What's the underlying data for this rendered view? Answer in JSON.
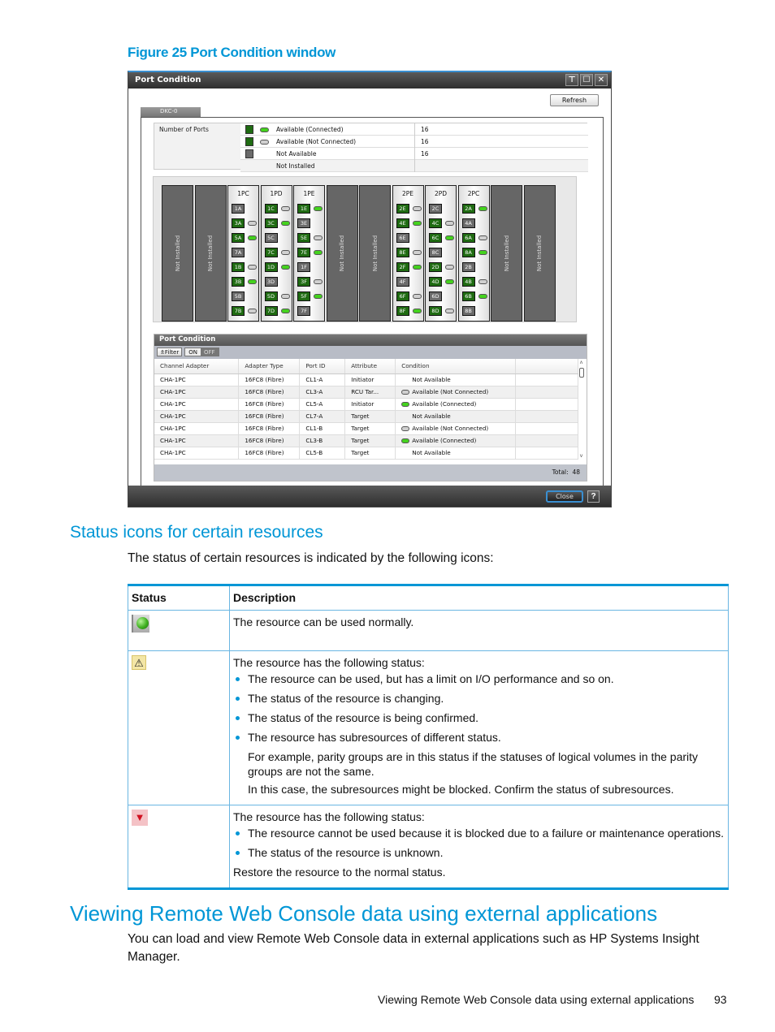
{
  "figure": {
    "caption": "Figure 25 Port Condition window"
  },
  "window": {
    "title": "Port Condition",
    "title_buttons": [
      "pin-icon",
      "maximize-icon",
      "close-icon"
    ],
    "title_button_glyphs": [
      "⊤",
      "☐",
      "✕"
    ],
    "refresh_label": "Refresh",
    "tab_label": "DKC-0",
    "number_of_ports": {
      "label": "Number of Ports",
      "rows": [
        {
          "square": "green",
          "pill": "green",
          "label": "Available (Connected)",
          "value": "16"
        },
        {
          "square": "green",
          "pill": "gray",
          "label": "Available (Not Connected)",
          "value": "16"
        },
        {
          "square": "gray",
          "pill": "",
          "label": "Not Available",
          "value": "16"
        },
        {
          "square": "",
          "pill": "",
          "label": "Not Installed",
          "value": ""
        }
      ]
    },
    "rack": {
      "not_installed_label": "Not Installed",
      "slots": [
        {
          "type": "ni"
        },
        {
          "type": "ni"
        },
        {
          "type": "ad",
          "name": "1PC",
          "ports": [
            {
              "id": "1A",
              "state": "gray",
              "led": ""
            },
            {
              "id": "3A",
              "state": "green",
              "led": "gray"
            },
            {
              "id": "5A",
              "state": "green",
              "led": "green"
            },
            {
              "id": "7A",
              "state": "gray",
              "led": ""
            },
            {
              "id": "1B",
              "state": "green",
              "led": "gray"
            },
            {
              "id": "3B",
              "state": "green",
              "led": "green"
            },
            {
              "id": "5B",
              "state": "gray",
              "led": ""
            },
            {
              "id": "7B",
              "state": "green",
              "led": "gray"
            }
          ]
        },
        {
          "type": "ad",
          "name": "1PD",
          "ports": [
            {
              "id": "1C",
              "state": "green",
              "led": "gray"
            },
            {
              "id": "3C",
              "state": "green",
              "led": "green"
            },
            {
              "id": "5C",
              "state": "gray",
              "led": ""
            },
            {
              "id": "7C",
              "state": "green",
              "led": "gray"
            },
            {
              "id": "1D",
              "state": "green",
              "led": "green"
            },
            {
              "id": "3D",
              "state": "gray",
              "led": ""
            },
            {
              "id": "5D",
              "state": "green",
              "led": "gray"
            },
            {
              "id": "7D",
              "state": "green",
              "led": "green"
            }
          ]
        },
        {
          "type": "ad",
          "name": "1PE",
          "ports": [
            {
              "id": "1E",
              "state": "green",
              "led": "green"
            },
            {
              "id": "3E",
              "state": "gray",
              "led": ""
            },
            {
              "id": "5E",
              "state": "green",
              "led": "gray"
            },
            {
              "id": "7E",
              "state": "green",
              "led": "green"
            },
            {
              "id": "1F",
              "state": "gray",
              "led": ""
            },
            {
              "id": "3F",
              "state": "green",
              "led": "gray"
            },
            {
              "id": "5F",
              "state": "green",
              "led": "green"
            },
            {
              "id": "7F",
              "state": "gray",
              "led": ""
            }
          ]
        },
        {
          "type": "ni"
        },
        {
          "type": "ni"
        },
        {
          "type": "ad",
          "name": "2PE",
          "ports": [
            {
              "id": "2E",
              "state": "green",
              "led": "gray"
            },
            {
              "id": "4E",
              "state": "green",
              "led": "green"
            },
            {
              "id": "6E",
              "state": "gray",
              "led": ""
            },
            {
              "id": "8E",
              "state": "green",
              "led": "gray"
            },
            {
              "id": "2F",
              "state": "green",
              "led": "green"
            },
            {
              "id": "4F",
              "state": "gray",
              "led": ""
            },
            {
              "id": "6F",
              "state": "green",
              "led": "gray"
            },
            {
              "id": "8F",
              "state": "green",
              "led": "green"
            }
          ]
        },
        {
          "type": "ad",
          "name": "2PD",
          "ports": [
            {
              "id": "2C",
              "state": "gray",
              "led": ""
            },
            {
              "id": "4C",
              "state": "green",
              "led": "gray"
            },
            {
              "id": "6C",
              "state": "green",
              "led": "green"
            },
            {
              "id": "8C",
              "state": "gray",
              "led": ""
            },
            {
              "id": "2D",
              "state": "green",
              "led": "gray"
            },
            {
              "id": "4D",
              "state": "green",
              "led": "green"
            },
            {
              "id": "6D",
              "state": "gray",
              "led": ""
            },
            {
              "id": "8D",
              "state": "green",
              "led": "gray"
            }
          ]
        },
        {
          "type": "ad",
          "name": "2PC",
          "ports": [
            {
              "id": "2A",
              "state": "green",
              "led": "green"
            },
            {
              "id": "4A",
              "state": "gray",
              "led": ""
            },
            {
              "id": "6A",
              "state": "green",
              "led": "gray"
            },
            {
              "id": "8A",
              "state": "green",
              "led": "green"
            },
            {
              "id": "2B",
              "state": "gray",
              "led": ""
            },
            {
              "id": "4B",
              "state": "green",
              "led": "gray"
            },
            {
              "id": "6B",
              "state": "green",
              "led": "green"
            },
            {
              "id": "8B",
              "state": "gray",
              "led": ""
            }
          ]
        },
        {
          "type": "ni"
        },
        {
          "type": "ni"
        }
      ]
    },
    "port_condition": {
      "title": "Port Condition",
      "filter_label": "Filter",
      "on_label": "ON",
      "off_label": "OFF",
      "columns": [
        "Channel Adapter",
        "Adapter Type",
        "Port ID",
        "Attribute",
        "Condition",
        ""
      ],
      "rows": [
        [
          "CHA-1PC",
          "16FC8 (Fibre)",
          "CL1-A",
          "Initiator",
          "none",
          "Not Available"
        ],
        [
          "CHA-1PC",
          "16FC8 (Fibre)",
          "CL3-A",
          "RCU Tar...",
          "gray",
          "Available (Not Connected)"
        ],
        [
          "CHA-1PC",
          "16FC8 (Fibre)",
          "CL5-A",
          "Initiator",
          "green",
          "Available (Connected)"
        ],
        [
          "CHA-1PC",
          "16FC8 (Fibre)",
          "CL7-A",
          "Target",
          "none",
          "Not Available"
        ],
        [
          "CHA-1PC",
          "16FC8 (Fibre)",
          "CL1-B",
          "Target",
          "gray",
          "Available (Not Connected)"
        ],
        [
          "CHA-1PC",
          "16FC8 (Fibre)",
          "CL3-B",
          "Target",
          "green",
          "Available (Connected)"
        ],
        [
          "CHA-1PC",
          "16FC8 (Fibre)",
          "CL5-B",
          "Target",
          "none",
          "Not Available"
        ]
      ],
      "total_label": "Total:",
      "total_value": "48"
    },
    "close_label": "Close",
    "help_label": "?"
  },
  "section1": {
    "heading": "Status icons for certain resources",
    "intro": "The status of certain resources is indicated by the following icons:",
    "table": {
      "headers": [
        "Status",
        "Description"
      ],
      "rows": [
        {
          "icon": "green-status-icon",
          "lead": "The resource can be used normally.",
          "bullets": [],
          "notes": [],
          "trailer": ""
        },
        {
          "icon": "warning-icon",
          "lead": "The resource has the following status:",
          "bullets": [
            "The resource can be used, but has a limit on I/O performance and so on.",
            "The status of the resource is changing.",
            "The status of the resource is being confirmed.",
            "The resource has subresources of different status."
          ],
          "notes": [
            "For example, parity groups are in this status if the statuses of logical volumes in the parity groups are not the same.",
            "In this case, the subresources might be blocked. Confirm the status of subresources."
          ],
          "trailer": ""
        },
        {
          "icon": "error-icon",
          "lead": "The resource has the following status:",
          "bullets": [
            "The resource cannot be used because it is blocked due to a failure or maintenance operations.",
            "The status of the resource is unknown."
          ],
          "notes": [],
          "trailer": "Restore the resource to the normal status."
        }
      ]
    }
  },
  "section2": {
    "heading": "Viewing Remote Web Console data using external applications",
    "body": "You can load and view Remote Web Console data in external applications such as HP Systems Insight Manager."
  },
  "footer": {
    "running_title": "Viewing Remote Web Console data using external applications",
    "page_number": "93"
  },
  "colors": {
    "accent": "#0096d6",
    "port_green": "#1f6b12",
    "led_green": "#44d21e",
    "port_gray": "#6b6b6b"
  }
}
